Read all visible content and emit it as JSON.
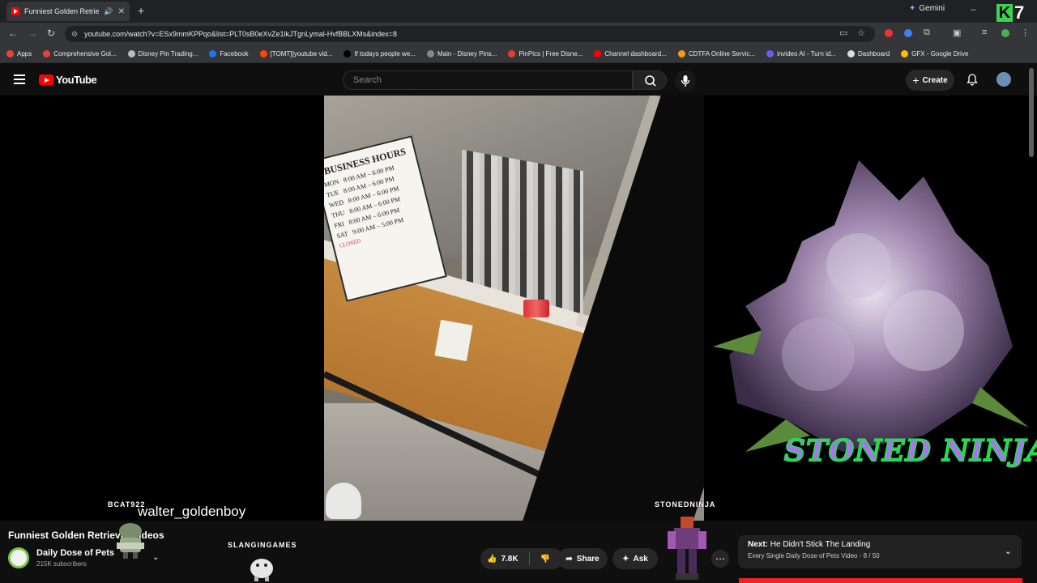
{
  "browser": {
    "tab_title": "Funniest Golden Retriever V",
    "url": "youtube.com/watch?v=ESx9mmKPPqo&list=PLT0sB0eXvZe1lkJTgnLymal-HvfBBLXMs&index=8",
    "gemini_label": "Gemini",
    "badge_number": "7",
    "bookmarks": [
      {
        "label": "Apps",
        "color": "#ea4335"
      },
      {
        "label": "Comprehensive Gol...",
        "color": "#ea4335"
      },
      {
        "label": "Disney Pin Trading...",
        "color": "#bbbbbb"
      },
      {
        "label": "Facebook",
        "color": "#1877f2"
      },
      {
        "label": "[TOMT]]youtube vid...",
        "color": "#ff4500"
      },
      {
        "label": "If todays people we...",
        "color": "#000000"
      },
      {
        "label": "Main - Disney Pins...",
        "color": "#888888"
      },
      {
        "label": "PinPics | Free Disne...",
        "color": "#e0402a"
      },
      {
        "label": "Channel dashboard...",
        "color": "#ff0000"
      },
      {
        "label": "CDTFA Online Servic...",
        "color": "#f39c12"
      },
      {
        "label": "invideo AI - Turn id...",
        "color": "#6c5ce7"
      },
      {
        "label": "Dashboard",
        "color": "#dddddd"
      },
      {
        "label": "GFX - Google Drive",
        "color": "#fbbc04"
      }
    ]
  },
  "youtube": {
    "logo_text": "YouTube",
    "search_placeholder": "Search",
    "create_label": "Create"
  },
  "video": {
    "sign_title": "BUSINESS HOURS",
    "sign_rows": [
      {
        "day": "MON",
        "hours": "8:00 AM – 6:00 PM"
      },
      {
        "day": "TUE",
        "hours": "8:00 AM – 6:00 PM"
      },
      {
        "day": "WED",
        "hours": "8:00 AM – 6:00 PM"
      },
      {
        "day": "THU",
        "hours": "8:00 AM – 6:00 PM"
      },
      {
        "day": "FRI",
        "hours": "8:00 AM – 6:00 PM"
      },
      {
        "day": "SAT",
        "hours": "9:00 AM – 5:00 PM"
      }
    ],
    "sign_closed": "CLOSED",
    "overlay_bcat": "BCAT922",
    "overlay_walter": "walter_goldenboy",
    "overlay_stoned": "STONEDNINJA",
    "overlay_slanging": "SLANGINGAMES",
    "overlay_banner": "STONED NINJA"
  },
  "details": {
    "title": "Funniest Golden Retriever Videos",
    "channel": "Daily Dose of Pets",
    "subscribers": "215K subscribers",
    "likes": "7.8K",
    "share_label": "Share",
    "ask_label": "Ask"
  },
  "next": {
    "prefix": "Next:",
    "title": "He Didn't Stick The Landing",
    "playlist": "Every Single Daily Dose of Pets Video",
    "position": "8 / 50"
  }
}
